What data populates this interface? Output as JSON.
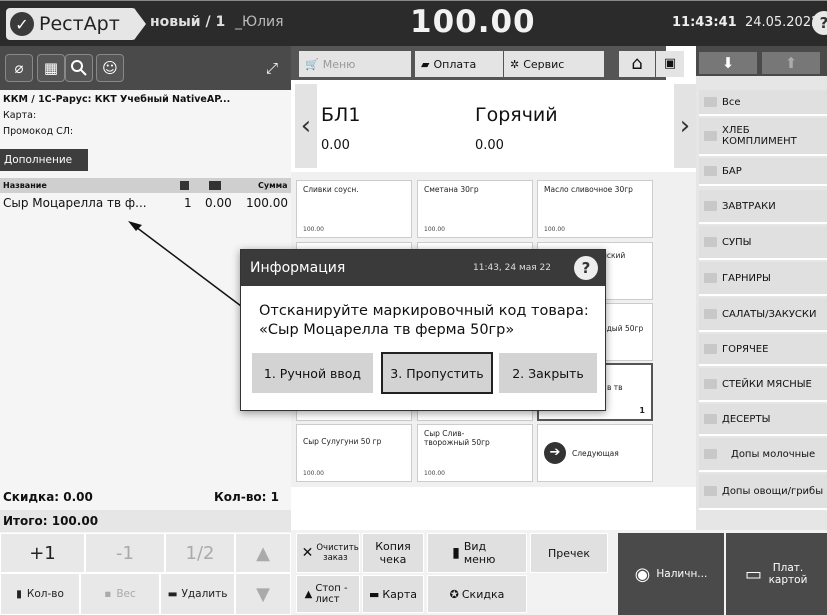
{
  "header": {
    "app_name": "РестАрт",
    "order": "новый / 1",
    "user": "_Юлия",
    "total": "100.00",
    "time": "11:43:41",
    "date": "24.05.2022"
  },
  "left": {
    "kkm_label": "ККМ / ФР:",
    "kkm_value": "ККМ / 1С-Рарус: ККТ Учебный NativeAP...",
    "card_label": "Карта:",
    "promo_label": "Промокод СЛ:",
    "extra_label": "Дополнение",
    "table": {
      "col_name": "Название",
      "col_sum": "Сумма",
      "rows": [
        {
          "name": "Сыр Моцарелла тв ф...",
          "qty": "1",
          "discount": "0.00",
          "sum": "100.00"
        }
      ]
    },
    "discount_label": "Скидка: 0.00",
    "count_label": "Кол-во: 1",
    "total_label": "Итого: 100.00",
    "keys": {
      "plus1": "+1",
      "minus1": "-1",
      "half": "1/2"
    },
    "actions": {
      "qty": "Кол-во",
      "weight": "Вес",
      "delete": "Удалить"
    }
  },
  "menu_tabs": {
    "menu": "Меню",
    "payment": "Оплата",
    "service": "Сервис"
  },
  "categories": [
    {
      "name": "БЛ1",
      "value": "0.00"
    },
    {
      "name": "Горячий",
      "value": "0.00"
    }
  ],
  "products": [
    {
      "name": "Сливки соусн.",
      "price": "100.00",
      "col": 0,
      "row": 0
    },
    {
      "name": "Сметана 30гр",
      "price": "100.00",
      "col": 1,
      "row": 0
    },
    {
      "name": "Масло сливочное 30гр",
      "price": "100.00",
      "col": 2,
      "row": 0
    },
    {
      "name": "Сыр Сулугуни 50 гр",
      "price": "100.00",
      "col": 0,
      "row": 4
    },
    {
      "name": "Сыр Слив-творожный 50гр",
      "price": "100.00",
      "col": 1,
      "row": 4
    },
    {
      "name": "Следующая",
      "price": "",
      "col": 2,
      "row": 4
    }
  ],
  "right_nav": [
    "Все",
    "ХЛЕБ КОМПЛИМЕНТ",
    "БАР",
    "ЗАВТРАКИ",
    "СУПЫ",
    "ГАРНИРЫ",
    "САЛАТЫ/ЗАКУСКИ",
    "ГОРЯЧЕЕ",
    "СТЕЙКИ МЯСНЫЕ",
    "ДЕСЕРТЫ",
    "Допы молочные",
    "Допы овощи/грибы"
  ],
  "bottom": {
    "clear_order": "Очистить заказ",
    "copy_check": "Копия чека",
    "menu_view": "Вид меню",
    "precheck": "Пречек",
    "cash": "Наличн...",
    "pay_card": "Плат. картой",
    "stop_list": "Стоп - лист",
    "card": "Карта",
    "discount": "Скидка"
  },
  "dialog": {
    "title": "Информация",
    "time": "11:43, 24 мая 22",
    "message": "Отсканируйте маркировочный код товара: «Сыр Моцарелла тв ферма 50гр»",
    "btn_manual": "1. Ручной ввод",
    "btn_skip": "3. Пропустить",
    "btn_close": "2. Закрыть"
  },
  "partial_texts": {
    "p1": "нский",
    "p2": "одый 50гр",
    "p3": "в тв",
    "p4": "1"
  },
  "colors": {
    "dark": "#2b2b2b",
    "panel": "#4a4a4a",
    "light": "#e6e6e6"
  }
}
